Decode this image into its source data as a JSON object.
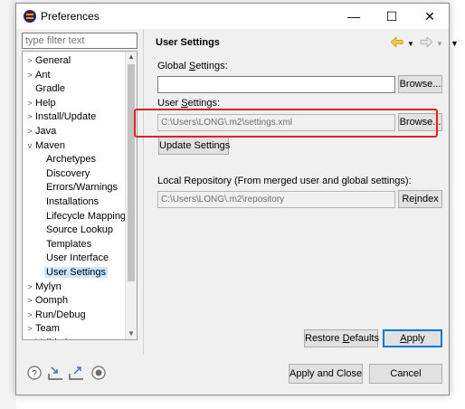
{
  "window": {
    "title": "Preferences",
    "minimize": "—",
    "maximize": "☐",
    "close": "✕"
  },
  "filter": {
    "placeholder": "type filter text"
  },
  "tree": {
    "items": [
      {
        "label": "General",
        "arrow": ">",
        "indent": 0
      },
      {
        "label": "Ant",
        "arrow": ">",
        "indent": 0
      },
      {
        "label": "Gradle",
        "arrow": "",
        "indent": 0
      },
      {
        "label": "Help",
        "arrow": ">",
        "indent": 0
      },
      {
        "label": "Install/Update",
        "arrow": ">",
        "indent": 0
      },
      {
        "label": "Java",
        "arrow": ">",
        "indent": 0
      },
      {
        "label": "Maven",
        "arrow": "v",
        "indent": 0
      },
      {
        "label": "Archetypes",
        "arrow": "",
        "indent": 1
      },
      {
        "label": "Discovery",
        "arrow": "",
        "indent": 1
      },
      {
        "label": "Errors/Warnings",
        "arrow": "",
        "indent": 1
      },
      {
        "label": "Installations",
        "arrow": "",
        "indent": 1
      },
      {
        "label": "Lifecycle Mappings",
        "arrow": "",
        "indent": 1
      },
      {
        "label": "Source Lookup",
        "arrow": "",
        "indent": 1
      },
      {
        "label": "Templates",
        "arrow": "",
        "indent": 1
      },
      {
        "label": "User Interface",
        "arrow": "",
        "indent": 1
      },
      {
        "label": "User Settings",
        "arrow": "",
        "indent": 1,
        "selected": true
      },
      {
        "label": "Mylyn",
        "arrow": ">",
        "indent": 0
      },
      {
        "label": "Oomph",
        "arrow": ">",
        "indent": 0
      },
      {
        "label": "Run/Debug",
        "arrow": ">",
        "indent": 0
      },
      {
        "label": "Team",
        "arrow": ">",
        "indent": 0
      },
      {
        "label": "Validation",
        "arrow": ">",
        "indent": 0
      }
    ]
  },
  "page": {
    "title": "User Settings",
    "global_label_pre": "Global ",
    "global_label_mn": "S",
    "global_label_post": "ettings:",
    "global_value": "",
    "browse1": "Browse...",
    "user_label_pre": "User ",
    "user_label_mn": "S",
    "user_label_post": "ettings:",
    "user_value": "C:\\Users\\LONG\\.m2\\settings.xml",
    "browse2": "Browse...",
    "update": "Update Settings",
    "local_label": "Local Repository (From merged user and global settings):",
    "local_value": "C:\\Users\\LONG\\.m2\\repository",
    "reindex_pre": "Re",
    "reindex_mn": "i",
    "reindex_post": "ndex",
    "restore_pre": "Restore ",
    "restore_mn": "D",
    "restore_post": "efaults",
    "apply_mn": "A",
    "apply_post": "pply"
  },
  "footer": {
    "apply_close": "Apply and Close",
    "cancel": "Cancel"
  },
  "colors": {
    "highlight": "#e02020",
    "selection": "#cce8ff",
    "default_button": "#0078d7"
  }
}
